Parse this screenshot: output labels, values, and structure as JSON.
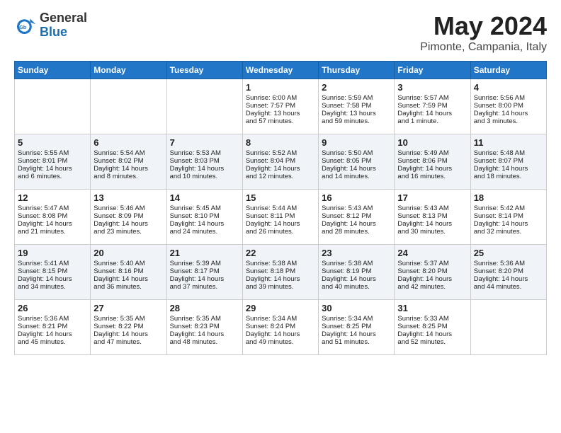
{
  "header": {
    "logo_general": "General",
    "logo_blue": "Blue",
    "month_title": "May 2024",
    "location": "Pimonte, Campania, Italy"
  },
  "days_of_week": [
    "Sunday",
    "Monday",
    "Tuesday",
    "Wednesday",
    "Thursday",
    "Friday",
    "Saturday"
  ],
  "weeks": [
    [
      {
        "day": "",
        "lines": []
      },
      {
        "day": "",
        "lines": []
      },
      {
        "day": "",
        "lines": []
      },
      {
        "day": "1",
        "lines": [
          "Sunrise: 6:00 AM",
          "Sunset: 7:57 PM",
          "Daylight: 13 hours",
          "and 57 minutes."
        ]
      },
      {
        "day": "2",
        "lines": [
          "Sunrise: 5:59 AM",
          "Sunset: 7:58 PM",
          "Daylight: 13 hours",
          "and 59 minutes."
        ]
      },
      {
        "day": "3",
        "lines": [
          "Sunrise: 5:57 AM",
          "Sunset: 7:59 PM",
          "Daylight: 14 hours",
          "and 1 minute."
        ]
      },
      {
        "day": "4",
        "lines": [
          "Sunrise: 5:56 AM",
          "Sunset: 8:00 PM",
          "Daylight: 14 hours",
          "and 3 minutes."
        ]
      }
    ],
    [
      {
        "day": "5",
        "lines": [
          "Sunrise: 5:55 AM",
          "Sunset: 8:01 PM",
          "Daylight: 14 hours",
          "and 6 minutes."
        ]
      },
      {
        "day": "6",
        "lines": [
          "Sunrise: 5:54 AM",
          "Sunset: 8:02 PM",
          "Daylight: 14 hours",
          "and 8 minutes."
        ]
      },
      {
        "day": "7",
        "lines": [
          "Sunrise: 5:53 AM",
          "Sunset: 8:03 PM",
          "Daylight: 14 hours",
          "and 10 minutes."
        ]
      },
      {
        "day": "8",
        "lines": [
          "Sunrise: 5:52 AM",
          "Sunset: 8:04 PM",
          "Daylight: 14 hours",
          "and 12 minutes."
        ]
      },
      {
        "day": "9",
        "lines": [
          "Sunrise: 5:50 AM",
          "Sunset: 8:05 PM",
          "Daylight: 14 hours",
          "and 14 minutes."
        ]
      },
      {
        "day": "10",
        "lines": [
          "Sunrise: 5:49 AM",
          "Sunset: 8:06 PM",
          "Daylight: 14 hours",
          "and 16 minutes."
        ]
      },
      {
        "day": "11",
        "lines": [
          "Sunrise: 5:48 AM",
          "Sunset: 8:07 PM",
          "Daylight: 14 hours",
          "and 18 minutes."
        ]
      }
    ],
    [
      {
        "day": "12",
        "lines": [
          "Sunrise: 5:47 AM",
          "Sunset: 8:08 PM",
          "Daylight: 14 hours",
          "and 21 minutes."
        ]
      },
      {
        "day": "13",
        "lines": [
          "Sunrise: 5:46 AM",
          "Sunset: 8:09 PM",
          "Daylight: 14 hours",
          "and 23 minutes."
        ]
      },
      {
        "day": "14",
        "lines": [
          "Sunrise: 5:45 AM",
          "Sunset: 8:10 PM",
          "Daylight: 14 hours",
          "and 24 minutes."
        ]
      },
      {
        "day": "15",
        "lines": [
          "Sunrise: 5:44 AM",
          "Sunset: 8:11 PM",
          "Daylight: 14 hours",
          "and 26 minutes."
        ]
      },
      {
        "day": "16",
        "lines": [
          "Sunrise: 5:43 AM",
          "Sunset: 8:12 PM",
          "Daylight: 14 hours",
          "and 28 minutes."
        ]
      },
      {
        "day": "17",
        "lines": [
          "Sunrise: 5:43 AM",
          "Sunset: 8:13 PM",
          "Daylight: 14 hours",
          "and 30 minutes."
        ]
      },
      {
        "day": "18",
        "lines": [
          "Sunrise: 5:42 AM",
          "Sunset: 8:14 PM",
          "Daylight: 14 hours",
          "and 32 minutes."
        ]
      }
    ],
    [
      {
        "day": "19",
        "lines": [
          "Sunrise: 5:41 AM",
          "Sunset: 8:15 PM",
          "Daylight: 14 hours",
          "and 34 minutes."
        ]
      },
      {
        "day": "20",
        "lines": [
          "Sunrise: 5:40 AM",
          "Sunset: 8:16 PM",
          "Daylight: 14 hours",
          "and 36 minutes."
        ]
      },
      {
        "day": "21",
        "lines": [
          "Sunrise: 5:39 AM",
          "Sunset: 8:17 PM",
          "Daylight: 14 hours",
          "and 37 minutes."
        ]
      },
      {
        "day": "22",
        "lines": [
          "Sunrise: 5:38 AM",
          "Sunset: 8:18 PM",
          "Daylight: 14 hours",
          "and 39 minutes."
        ]
      },
      {
        "day": "23",
        "lines": [
          "Sunrise: 5:38 AM",
          "Sunset: 8:19 PM",
          "Daylight: 14 hours",
          "and 40 minutes."
        ]
      },
      {
        "day": "24",
        "lines": [
          "Sunrise: 5:37 AM",
          "Sunset: 8:20 PM",
          "Daylight: 14 hours",
          "and 42 minutes."
        ]
      },
      {
        "day": "25",
        "lines": [
          "Sunrise: 5:36 AM",
          "Sunset: 8:20 PM",
          "Daylight: 14 hours",
          "and 44 minutes."
        ]
      }
    ],
    [
      {
        "day": "26",
        "lines": [
          "Sunrise: 5:36 AM",
          "Sunset: 8:21 PM",
          "Daylight: 14 hours",
          "and 45 minutes."
        ]
      },
      {
        "day": "27",
        "lines": [
          "Sunrise: 5:35 AM",
          "Sunset: 8:22 PM",
          "Daylight: 14 hours",
          "and 47 minutes."
        ]
      },
      {
        "day": "28",
        "lines": [
          "Sunrise: 5:35 AM",
          "Sunset: 8:23 PM",
          "Daylight: 14 hours",
          "and 48 minutes."
        ]
      },
      {
        "day": "29",
        "lines": [
          "Sunrise: 5:34 AM",
          "Sunset: 8:24 PM",
          "Daylight: 14 hours",
          "and 49 minutes."
        ]
      },
      {
        "day": "30",
        "lines": [
          "Sunrise: 5:34 AM",
          "Sunset: 8:25 PM",
          "Daylight: 14 hours",
          "and 51 minutes."
        ]
      },
      {
        "day": "31",
        "lines": [
          "Sunrise: 5:33 AM",
          "Sunset: 8:25 PM",
          "Daylight: 14 hours",
          "and 52 minutes."
        ]
      },
      {
        "day": "",
        "lines": []
      }
    ]
  ]
}
